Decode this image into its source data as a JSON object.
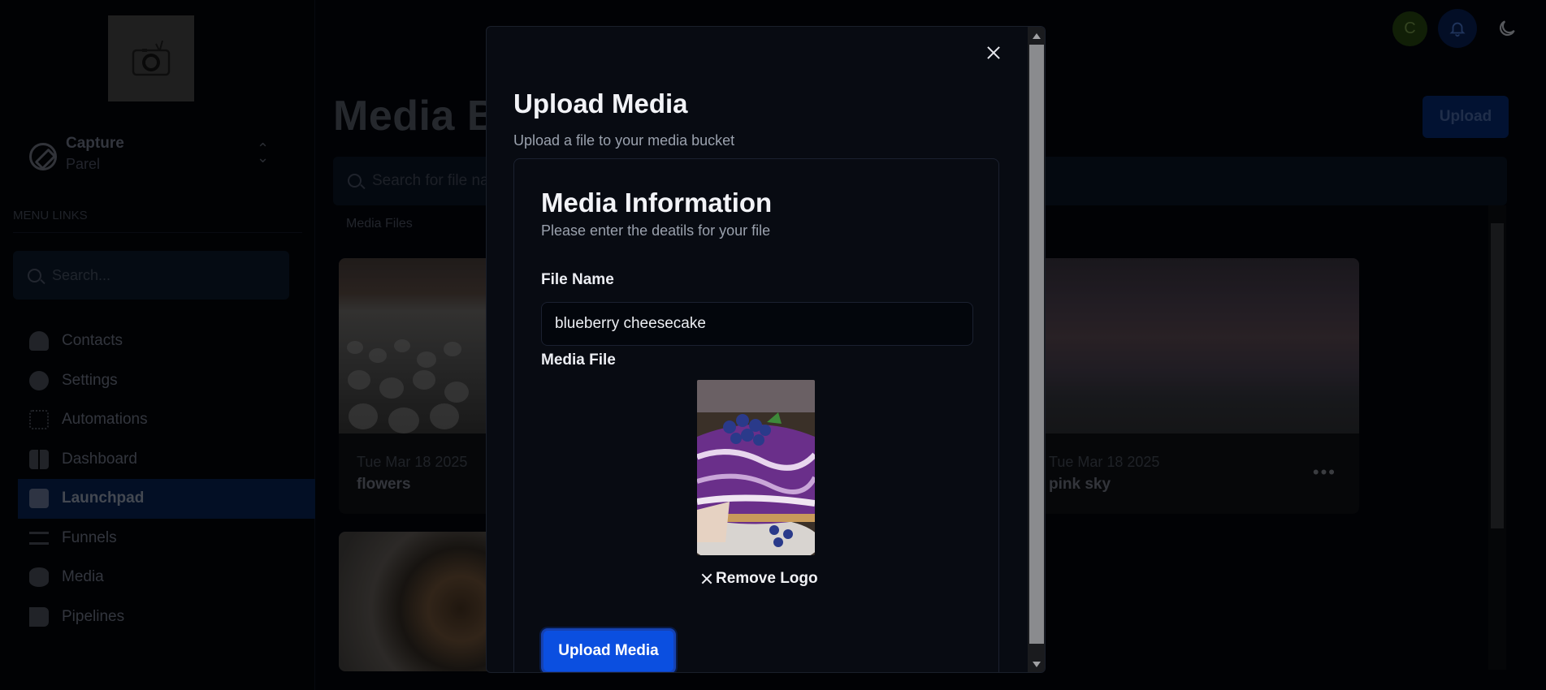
{
  "sidebar": {
    "workspace": {
      "name": "Capture",
      "sub": "Parel"
    },
    "menu_label": "MENU LINKS",
    "search_placeholder": "Search...",
    "items": [
      {
        "label": "Contacts",
        "icon": "user-icon"
      },
      {
        "label": "Settings",
        "icon": "gear-icon"
      },
      {
        "label": "Automations",
        "icon": "chip-icon"
      },
      {
        "label": "Dashboard",
        "icon": "grid-icon"
      },
      {
        "label": "Launchpad",
        "icon": "clipboard-icon",
        "active": true
      },
      {
        "label": "Funnels",
        "icon": "shuffle-icon"
      },
      {
        "label": "Media",
        "icon": "database-icon"
      },
      {
        "label": "Pipelines",
        "icon": "flag-icon"
      }
    ]
  },
  "topbar": {
    "avatar_initial": "C"
  },
  "main": {
    "title": "Media Bu",
    "upload_label": "Upload",
    "search_placeholder": "Search for file na",
    "section_label": "Media Files",
    "cards": [
      {
        "date": "Tue Mar 18 2025",
        "name": "flowers"
      },
      {
        "date": "Tue Mar 18 2025",
        "name": "pink sky"
      },
      {
        "date": "",
        "name": ""
      }
    ]
  },
  "modal": {
    "title": "Upload Media",
    "subtitle": "Upload a file to your media bucket",
    "card_title": "Media Information",
    "card_subtitle": "Please enter the deatils for your file",
    "file_name_label": "File Name",
    "file_name_value": "blueberry cheesecake",
    "media_file_label": "Media File",
    "remove_label": "Remove Logo",
    "submit_label": "Upload Media"
  },
  "colors": {
    "accent": "#0b4fe0",
    "background": "#02040a",
    "active_nav": "#061c44"
  }
}
